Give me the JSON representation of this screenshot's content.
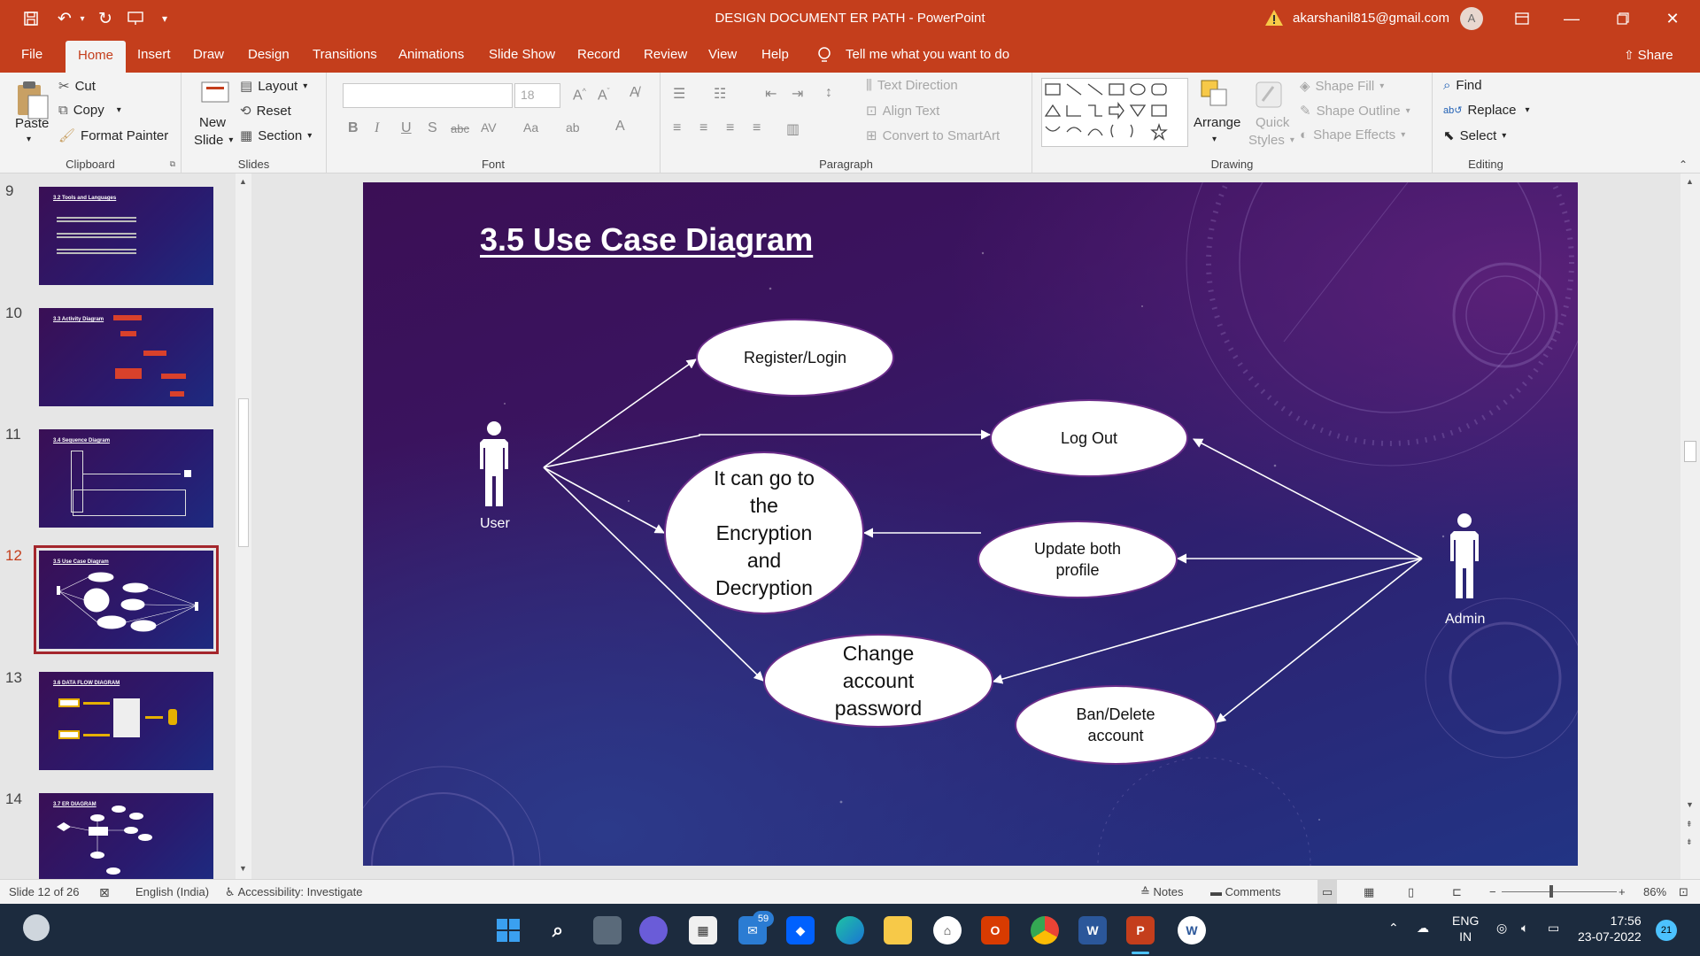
{
  "window": {
    "title": "DESIGN DOCUMENT ER PATH  -  PowerPoint",
    "account_email": "akarshanil815@gmail.com",
    "avatar_initial": "A"
  },
  "tabs": [
    "File",
    "Home",
    "Insert",
    "Draw",
    "Design",
    "Transitions",
    "Animations",
    "Slide Show",
    "Record",
    "Review",
    "View",
    "Help"
  ],
  "active_tab": "Home",
  "tell_me": "Tell me what you want to do",
  "share_label": "Share",
  "ribbon": {
    "clipboard": {
      "paste": "Paste",
      "cut": "Cut",
      "copy": "Copy",
      "format_painter": "Format Painter",
      "label": "Clipboard"
    },
    "slides": {
      "new_slide_1": "New",
      "new_slide_2": "Slide",
      "layout": "Layout",
      "reset": "Reset",
      "section": "Section",
      "label": "Slides"
    },
    "font": {
      "font_name": "",
      "font_size": "18",
      "label": "Font"
    },
    "paragraph": {
      "text_direction": "Text Direction",
      "align_text": "Align Text",
      "convert_smartart": "Convert to SmartArt",
      "label": "Paragraph"
    },
    "drawing": {
      "arrange": "Arrange",
      "quick_styles_1": "Quick",
      "quick_styles_2": "Styles",
      "shape_fill": "Shape Fill",
      "shape_outline": "Shape Outline",
      "shape_effects": "Shape Effects",
      "label": "Drawing"
    },
    "editing": {
      "find": "Find",
      "replace": "Replace",
      "select": "Select",
      "label": "Editing"
    }
  },
  "thumbnails": [
    {
      "num": "9",
      "title": "3.2 Tools and Languages"
    },
    {
      "num": "10",
      "title": "3.3 Activity Diagram"
    },
    {
      "num": "11",
      "title": "3.4 Sequence Diagram"
    },
    {
      "num": "12",
      "title": "3.5 Use Case Diagram"
    },
    {
      "num": "13",
      "title": "3.6 DATA FLOW DIAGRAM"
    },
    {
      "num": "14",
      "title": "3.7 ER DIAGRAM"
    }
  ],
  "slide": {
    "title": "3.5 Use Case Diagram",
    "actors": {
      "user": "User",
      "admin": "Admin"
    },
    "use_cases": {
      "register": "Register/Login",
      "logout": "Log Out",
      "encryption": [
        "It can go to",
        "the",
        "Encryption",
        "and",
        "Decryption"
      ],
      "update": [
        "Update both",
        "profile"
      ],
      "change_password": [
        "Change",
        "account",
        "password"
      ],
      "ban": [
        "Ban/Delete",
        "account"
      ]
    }
  },
  "status": {
    "slide_info": "Slide 12 of 26",
    "language": "English (India)",
    "accessibility": "Accessibility: Investigate",
    "notes": "Notes",
    "comments": "Comments",
    "zoom": "86%"
  },
  "taskbar": {
    "mail_badge": "59",
    "lang_1": "ENG",
    "lang_2": "IN",
    "time": "17:56",
    "date": "23-07-2022",
    "notif_count": "21"
  }
}
